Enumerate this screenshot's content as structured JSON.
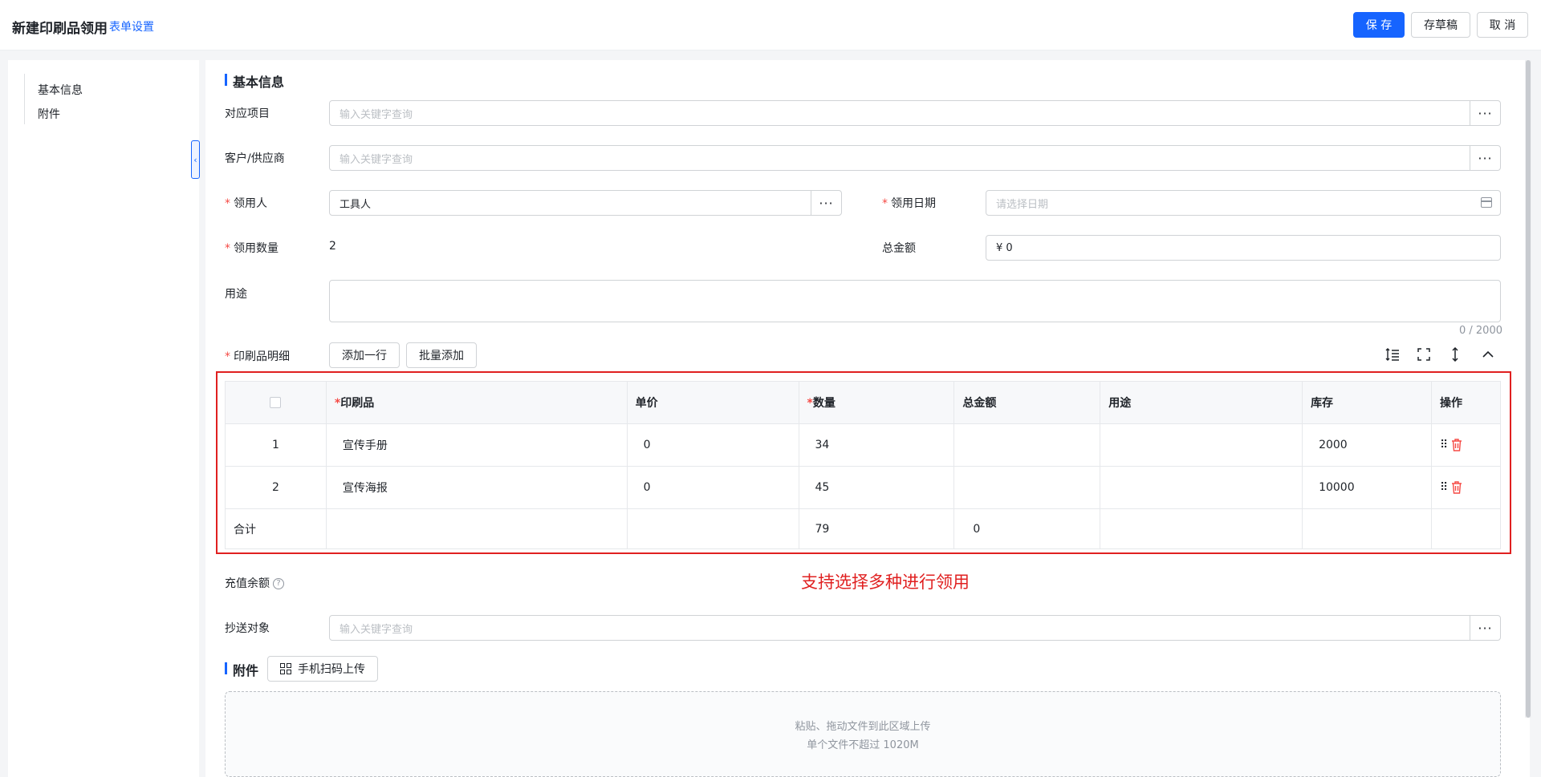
{
  "header": {
    "title": "新建印刷品领用",
    "form_settings": "表单设置",
    "save": "保 存",
    "draft": "存草稿",
    "cancel": "取 消"
  },
  "nav": {
    "items": [
      "基本信息",
      "附件"
    ]
  },
  "basic": {
    "section_title": "基本信息",
    "project_label": "对应项目",
    "project_placeholder": "输入关键字查询",
    "customer_label": "客户/供应商",
    "customer_placeholder": "输入关键字查询",
    "recipient_label": "领用人",
    "recipient_value": "工具人",
    "date_label": "领用日期",
    "date_placeholder": "请选择日期",
    "qty_label": "领用数量",
    "qty_value": "2",
    "total_label": "总金额",
    "total_value": "¥  0",
    "purpose_label": "用途",
    "purpose_counter": "0 / 2000",
    "required_mark": "*"
  },
  "details": {
    "label": "印刷品明细",
    "add_row": "添加一行",
    "batch_add": "批量添加",
    "columns": [
      "印刷品",
      "单价",
      "数量",
      "总金额",
      "用途",
      "库存",
      "操作"
    ],
    "required_mark": "*",
    "rows": [
      {
        "index": "1",
        "item": "宣传手册",
        "price": "0",
        "qty": "34",
        "amount": "",
        "purpose": "",
        "stock": "2000"
      },
      {
        "index": "2",
        "item": "宣传海报",
        "price": "0",
        "qty": "45",
        "amount": "",
        "purpose": "",
        "stock": "10000"
      }
    ],
    "total": {
      "label": "合计",
      "qty": "79",
      "amount": "0"
    }
  },
  "annotation": "支持选择多种进行领用",
  "recharge_label": "充值余额",
  "help_glyph": "?",
  "cc": {
    "label": "抄送对象",
    "placeholder": "输入关键字查询"
  },
  "attachment": {
    "section_title": "附件",
    "scan_upload": "手机扫码上传",
    "upload_line1": "粘贴、拖动文件到此区域上传",
    "upload_line2": "单个文件不超过 1020M"
  },
  "colors": {
    "primary": "#1664ff",
    "danger": "#f54a45",
    "annotation": "#e02020"
  }
}
